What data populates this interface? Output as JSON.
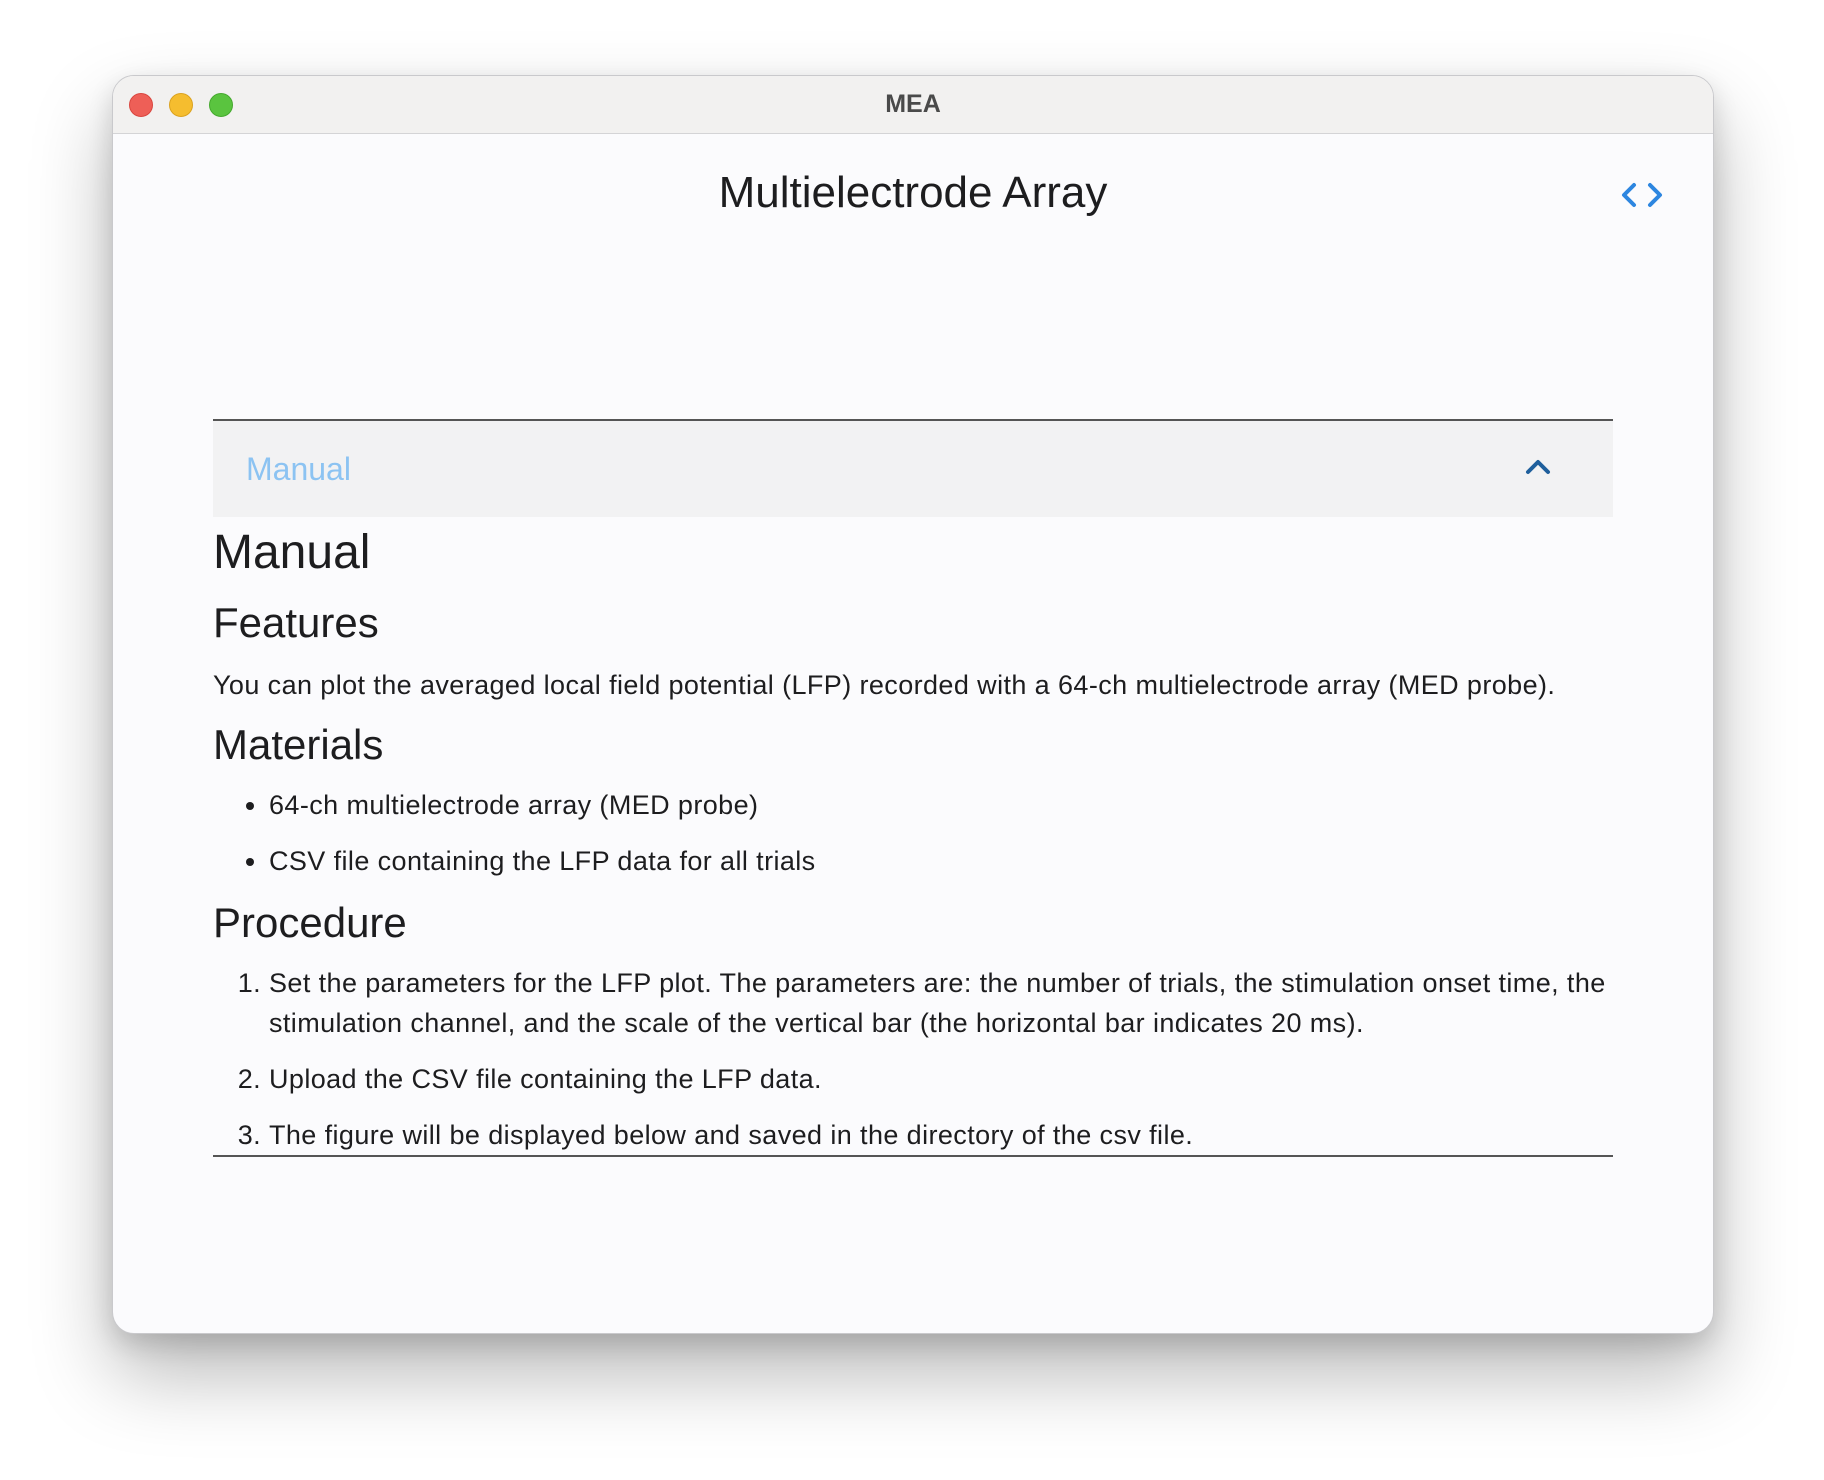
{
  "window": {
    "title": "MEA"
  },
  "header": {
    "page_title": "Multielectrode Array",
    "code_toggle_icon": "code-brackets-icon",
    "accent_color": "#2d86e0"
  },
  "accordion": {
    "label": "Manual",
    "expanded": true,
    "label_color": "#8cc3f2",
    "toggle_icon": "chevron-up-icon"
  },
  "manual": {
    "heading": "Manual",
    "features": {
      "heading": "Features",
      "text": "You can plot the averaged local field potential (LFP) recorded with a 64-ch multielectrode array (MED probe)."
    },
    "materials": {
      "heading": "Materials",
      "items": [
        "64-ch multielectrode array (MED probe)",
        "CSV file containing the LFP data for all trials"
      ]
    },
    "procedure": {
      "heading": "Procedure",
      "steps": [
        "Set the parameters for the LFP plot. The parameters are: the number of trials, the stimulation onset time, the stimulation channel, and the scale of the vertical bar (the horizontal bar indicates 20 ms).",
        "Upload the CSV file containing the LFP data.",
        "The figure will be displayed below and saved in the directory of the csv file."
      ]
    }
  }
}
